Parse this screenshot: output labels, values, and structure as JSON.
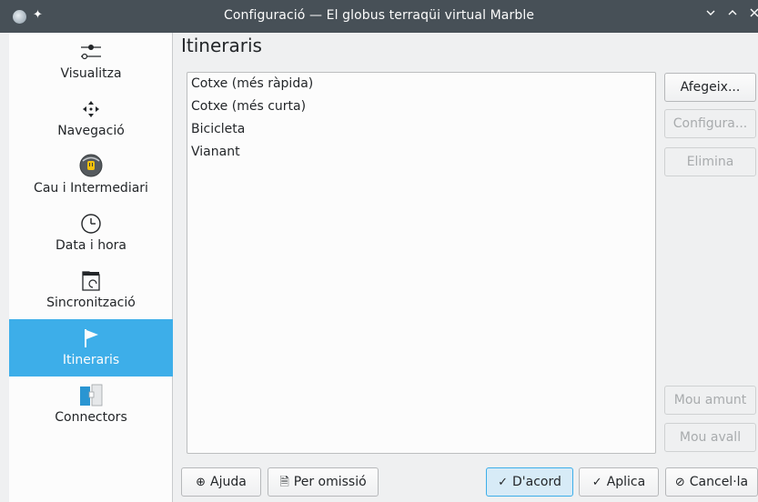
{
  "window": {
    "title": "Configuració — El globus terraqüi virtual Marble",
    "controls": [
      "minimize",
      "maximize",
      "close"
    ]
  },
  "sidebar": {
    "items": [
      {
        "label": "Visualitza",
        "icon": "sliders-icon",
        "selected": false
      },
      {
        "label": "Navegació",
        "icon": "move-arrows-icon",
        "selected": false
      },
      {
        "label": "Cau i Intermediari",
        "icon": "cache-proxy-icon",
        "selected": false
      },
      {
        "label": "Data i hora",
        "icon": "clock-icon",
        "selected": false
      },
      {
        "label": "Sincronització",
        "icon": "folder-sync-icon",
        "selected": false
      },
      {
        "label": "Itineraris",
        "icon": "flag-icon",
        "selected": true
      },
      {
        "label": "Connectors",
        "icon": "plugin-icon",
        "selected": false
      }
    ]
  },
  "main": {
    "title": "Itineraris",
    "routing_profiles": [
      "Cotxe (més ràpida)",
      "Cotxe (més curta)",
      "Bicicleta",
      "Vianant"
    ],
    "side_buttons": {
      "add": "Afegeix...",
      "configure": "Configura...",
      "remove": "Elimina",
      "move_up": "Mou amunt",
      "move_down": "Mou avall"
    }
  },
  "footer": {
    "help": "Ajuda",
    "defaults": "Per omissió",
    "ok": "D'acord",
    "apply": "Aplica",
    "cancel": "Cancel·la"
  },
  "colors": {
    "titlebar": "#475057",
    "selection": "#3daee9",
    "window_bg": "#eff0f1",
    "view_bg": "#fcfcfc"
  }
}
